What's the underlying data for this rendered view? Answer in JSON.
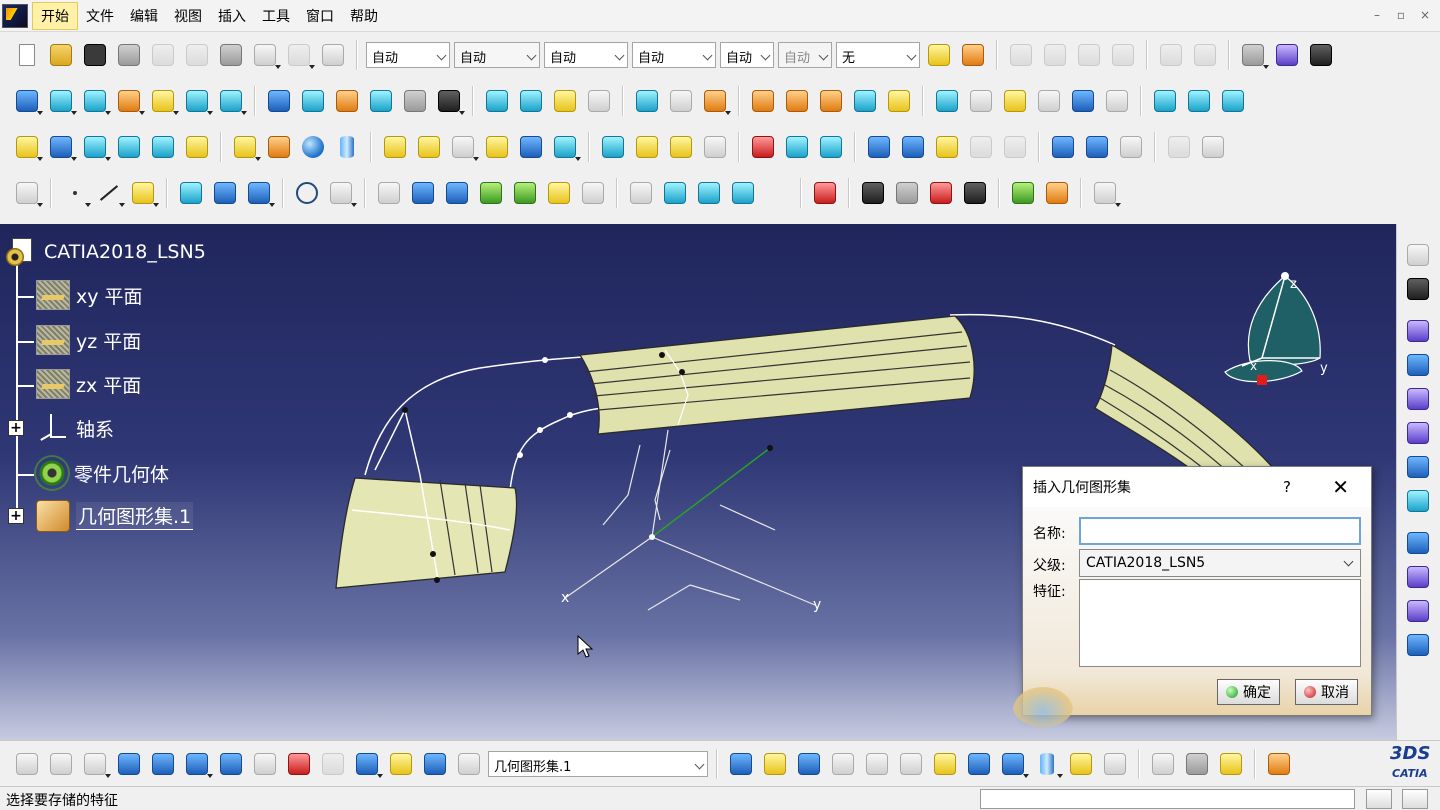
{
  "menu": {
    "items": [
      "开始",
      "文件",
      "编辑",
      "视图",
      "插入",
      "工具",
      "窗口",
      "帮助"
    ]
  },
  "window_controls": [
    "–",
    "▫",
    "×"
  ],
  "toolbar": {
    "combos": [
      "自动",
      "自动",
      "自动",
      "自动",
      "自动",
      "自动",
      "无"
    ]
  },
  "tree": {
    "root": "CATIA2018_LSN5",
    "nodes": [
      "xy 平面",
      "yz 平面",
      "zx 平面",
      "轴系",
      "零件几何体",
      "几何图形集.1"
    ]
  },
  "compass": {
    "z_label": "z",
    "y_label": "y",
    "x_label": "x"
  },
  "axes": {
    "x_label": "x",
    "y_label": "y"
  },
  "dialog": {
    "title": "插入几何图形集",
    "help": "?",
    "close": "✕",
    "name_label": "名称:",
    "name_value": "",
    "parent_label": "父级:",
    "parent_value": "CATIA2018_LSN5",
    "features_label": "特征:",
    "ok_label": "确定",
    "cancel_label": "取消"
  },
  "bottom": {
    "current_set": "几何图形集.1",
    "logo_top": "3DS",
    "logo_bottom": "CATIA"
  },
  "status": {
    "text": "选择要存储的特征"
  },
  "colors": {
    "viewport_top": "#20265c",
    "surface": "#e4e6b0",
    "dialog_accent": "#6fa4d8"
  }
}
